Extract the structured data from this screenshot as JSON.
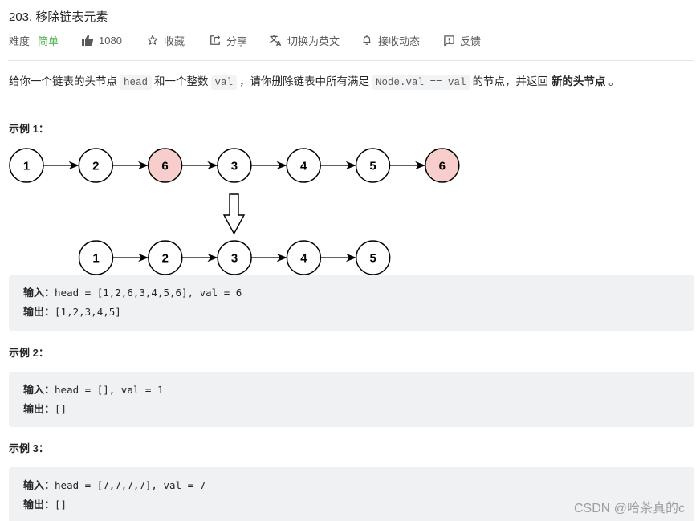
{
  "problem": {
    "title": "203. 移除链表元素",
    "difficulty_label": "难度",
    "difficulty_value": "简单",
    "likes": "1080",
    "actions": {
      "favorite": "收藏",
      "share": "分享",
      "switch_lang": "切换为英文",
      "subscribe": "接收动态",
      "feedback": "反馈"
    },
    "description": {
      "part1": "给你一个链表的头节点",
      "code1": "head",
      "part2": "和一个整数",
      "code2": "val",
      "part3": "，请你删除链表中所有满足",
      "code3": "Node.val == val",
      "part4": "的节点，并返回",
      "bold": "新的头节点",
      "part5": "。"
    }
  },
  "colors": {
    "difficulty_easy": "#5cb85c",
    "removed_node_fill": "#f8cecc",
    "code_bg": "#f0f1f3"
  },
  "diagram": {
    "before": [
      {
        "value": "1",
        "removed": false
      },
      {
        "value": "2",
        "removed": false
      },
      {
        "value": "6",
        "removed": true
      },
      {
        "value": "3",
        "removed": false
      },
      {
        "value": "4",
        "removed": false
      },
      {
        "value": "5",
        "removed": false
      },
      {
        "value": "6",
        "removed": true
      }
    ],
    "after": [
      "1",
      "2",
      "3",
      "4",
      "5"
    ]
  },
  "examples": [
    {
      "title": "示例 1：",
      "input_label": "输入：",
      "input": "head = [1,2,6,3,4,5,6], val = 6",
      "output_label": "输出：",
      "output": "[1,2,3,4,5]"
    },
    {
      "title": "示例 2：",
      "input_label": "输入：",
      "input": "head = [], val = 1",
      "output_label": "输出：",
      "output": "[]"
    },
    {
      "title": "示例 3：",
      "input_label": "输入：",
      "input": "head = [7,7,7,7], val = 7",
      "output_label": "输出：",
      "output": "[]"
    }
  ],
  "watermark": "CSDN @哈茶真的c"
}
